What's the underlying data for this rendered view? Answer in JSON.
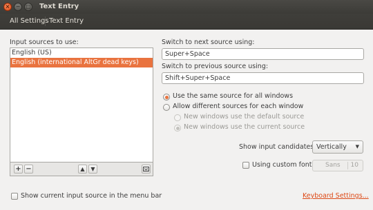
{
  "window": {
    "title": "Text Entry",
    "close_glyph": "×",
    "minimize_glyph": "−",
    "maximize_glyph": "□"
  },
  "toolbar": {
    "crumbs": [
      {
        "label": "All Settings"
      },
      {
        "label": "Text Entry"
      }
    ]
  },
  "sources": {
    "label": "Input sources to use:",
    "items": [
      {
        "label": "English (US)",
        "selected": false
      },
      {
        "label": "English (international AltGr dead keys)",
        "selected": true
      }
    ],
    "add_glyph": "+",
    "remove_glyph": "−",
    "up_glyph": "▲",
    "down_glyph": "▼"
  },
  "switching": {
    "next_label": "Switch to next source using:",
    "next_value": "Super+Space",
    "prev_label": "Switch to previous source using:",
    "prev_value": "Shift+Super+Space"
  },
  "options": {
    "same_source": "Use the same source for all windows",
    "different_sources": "Allow different sources for each window",
    "new_default": "New windows use the default source",
    "new_current": "New windows use the current source"
  },
  "candidates": {
    "label": "Show input candidates:",
    "value": "Vertically",
    "arrow": "▼"
  },
  "custom_font": {
    "label": "Using custom font:",
    "checked": false,
    "font_name": "Sans",
    "font_size": "10"
  },
  "footer": {
    "show_current": "Show current input source in the menu bar",
    "keyboard_settings": "Keyboard Settings..."
  },
  "colors": {
    "accent": "#e9733f",
    "selection": "#e9733f",
    "link": "#dd4814",
    "titlebar": "#3c3b37"
  }
}
